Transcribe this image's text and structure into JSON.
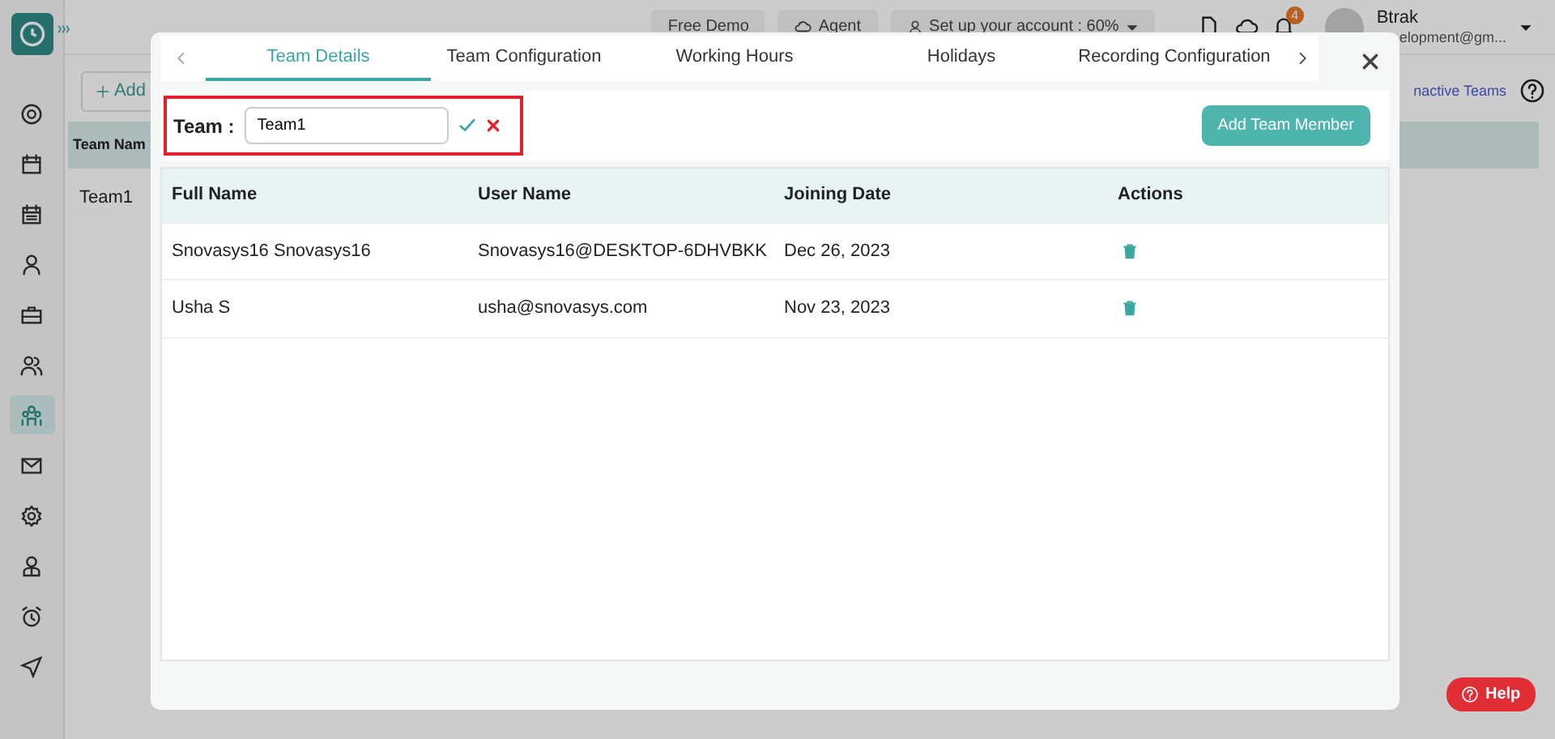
{
  "header": {
    "buttons": [
      "Free Demo",
      "Agent"
    ],
    "setup": "Set up your account : 60%",
    "notification_count": "4",
    "user_name": "Btrak",
    "user_email": "elopment@gm..."
  },
  "sidebar": {
    "items": [
      {
        "selected": false
      },
      {
        "selected": false
      },
      {
        "selected": false
      },
      {
        "selected": false
      },
      {
        "selected": false
      },
      {
        "selected": false
      },
      {
        "selected": true
      },
      {
        "selected": false
      },
      {
        "selected": false
      },
      {
        "selected": false
      },
      {
        "selected": false
      },
      {
        "selected": false
      }
    ]
  },
  "background_page": {
    "add_button": "Add",
    "table_header": "Team Nam",
    "row": "Team1",
    "link": "nactive Teams"
  },
  "modal": {
    "tabs": [
      {
        "label": "Team Details",
        "selected": true
      },
      {
        "label": "Team Configuration",
        "selected": false
      },
      {
        "label": "Working Hours",
        "selected": false
      },
      {
        "label": "Holidays",
        "selected": false
      },
      {
        "label": "Recording Configuration",
        "selected": false
      }
    ],
    "team_label": "Team :",
    "team_value": "Team1",
    "add_button": "Add Team Member",
    "columns": [
      "Full Name",
      "User Name",
      "Joining Date",
      "Actions"
    ],
    "rows": [
      {
        "full_name": "Snovasys16 Snovasys16",
        "user_name": "Snovasys16@DESKTOP-6DHVBKK",
        "joining_date": "Dec 26, 2023"
      },
      {
        "full_name": "Usha S",
        "user_name": "usha@snovasys.com",
        "joining_date": "Nov 23, 2023"
      }
    ]
  },
  "help_button": "Help"
}
